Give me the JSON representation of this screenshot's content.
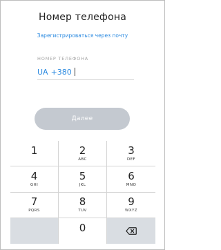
{
  "header": {
    "title": "Номер телефона",
    "email_link": "Зарегистрироваться через почту"
  },
  "phone_field": {
    "label": "НОМЕР ТЕЛЕФОНА",
    "country_code": "UA",
    "dial_code": "+380",
    "value": ""
  },
  "next_button": {
    "label": "Далее"
  },
  "keypad": {
    "keys": [
      {
        "digit": "1",
        "letters": ""
      },
      {
        "digit": "2",
        "letters": "ABC"
      },
      {
        "digit": "3",
        "letters": "DEF"
      },
      {
        "digit": "4",
        "letters": "GHI"
      },
      {
        "digit": "5",
        "letters": "JKL"
      },
      {
        "digit": "6",
        "letters": "MNO"
      },
      {
        "digit": "7",
        "letters": "PQRS"
      },
      {
        "digit": "8",
        "letters": "TUV"
      },
      {
        "digit": "9",
        "letters": "WXYZ"
      },
      {
        "digit": "0",
        "letters": ""
      }
    ],
    "backspace_icon": "backspace-icon"
  },
  "colors": {
    "accent": "#2b8ae0",
    "button_disabled": "#c4c9d0",
    "key_gray": "#d9dde2"
  }
}
